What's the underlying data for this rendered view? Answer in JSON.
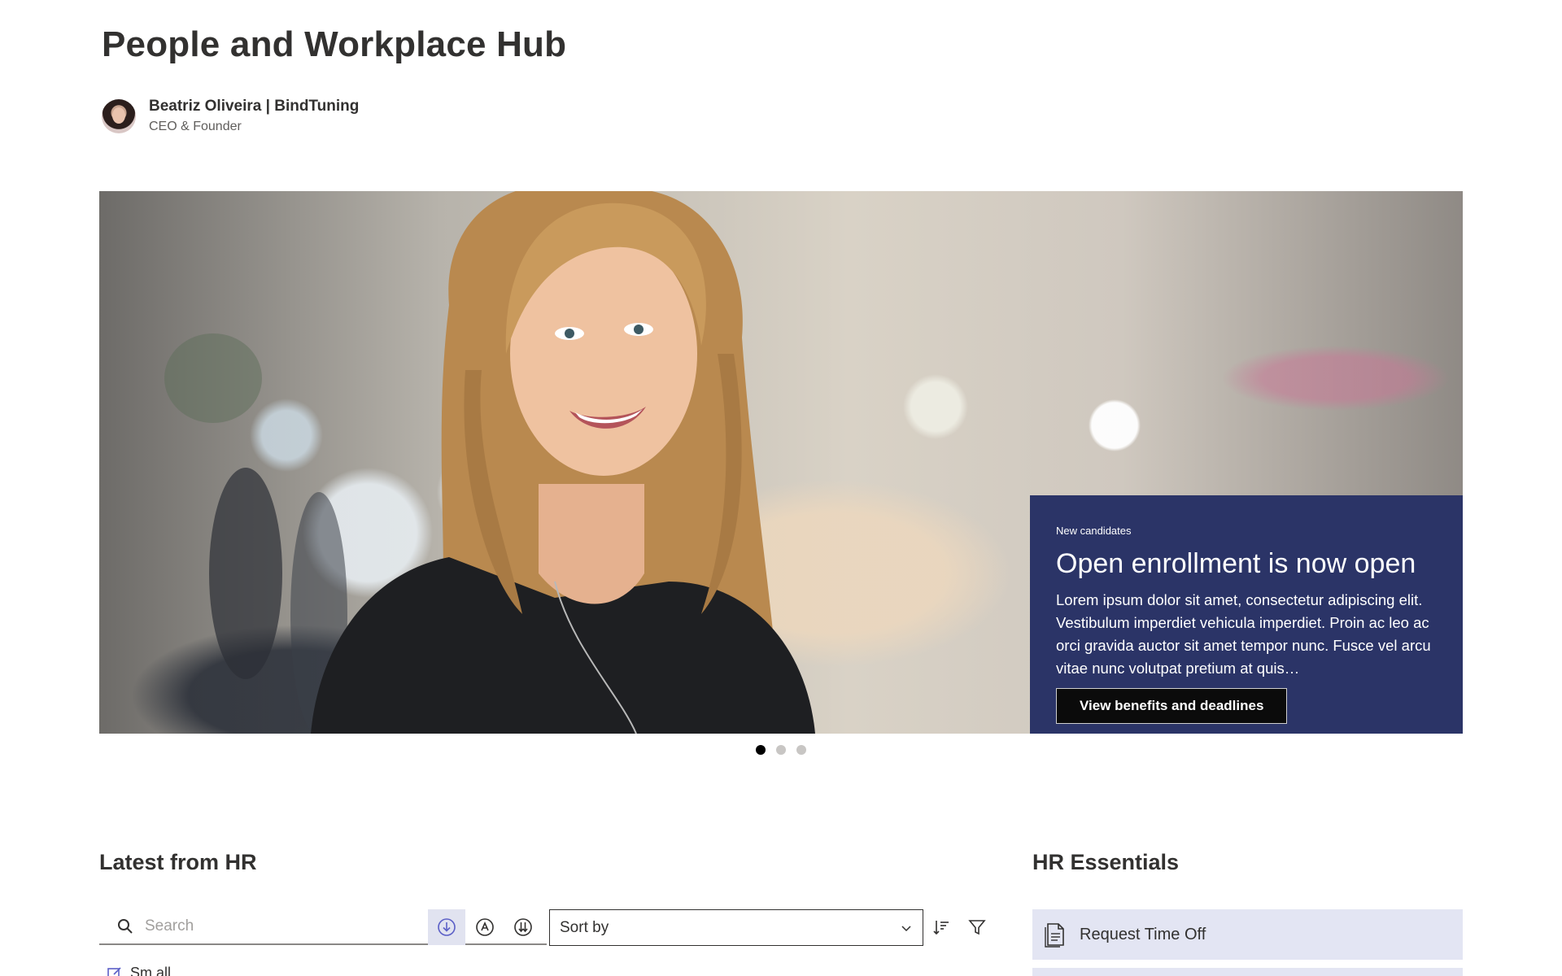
{
  "page": {
    "title": "People and Workplace Hub",
    "author": {
      "name": "Beatriz Oliveira | BindTuning",
      "role": "CEO & Founder"
    }
  },
  "hero": {
    "slide": {
      "tag": "New candidates",
      "title": "Open enrollment is now open",
      "body": "Lorem ipsum dolor sit amet, consectetur adipiscing elit. Vestibulum imperdiet vehicula imperdiet. Proin ac leo ac orci gravida auctor sit amet tempor nunc. Fusce vel arcu vitae nunc volutpat pretium at quis…",
      "button_label": "View benefits and deadlines"
    },
    "slide_count": 3,
    "active_slide": 1,
    "colors": {
      "overlay": "#2b3467",
      "button": "#0b0b0b"
    }
  },
  "latest": {
    "title": "Latest from HR",
    "search_placeholder": "Search",
    "sort_label": "Sort by",
    "partial_item_label": "Sm all"
  },
  "essentials": {
    "title": "HR Essentials",
    "items": [
      {
        "label": "Request Time Off",
        "icon": "document-icon"
      }
    ],
    "accent_bg": "#e3e5f3"
  }
}
